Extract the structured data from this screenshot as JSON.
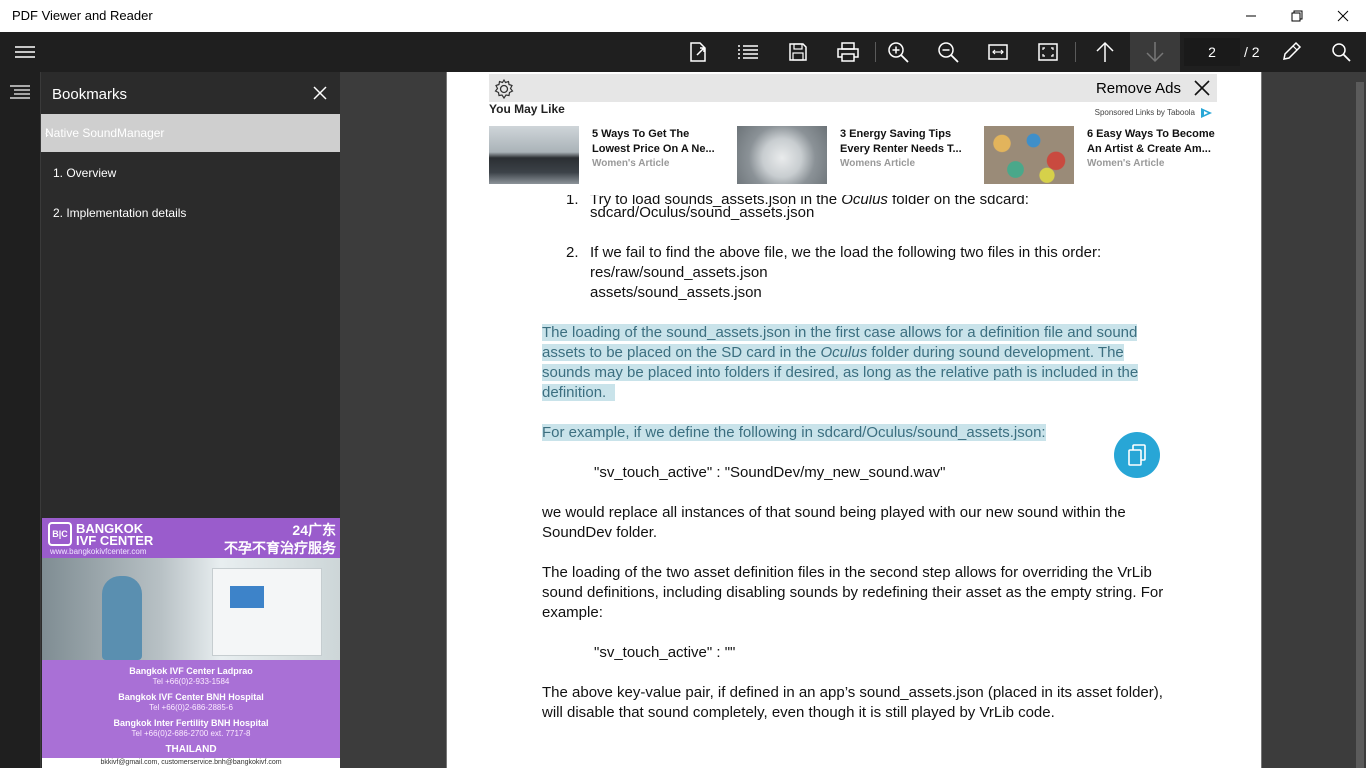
{
  "window": {
    "title": "PDF Viewer and Reader"
  },
  "toolbar": {
    "current_page": "2",
    "total_pages": "/ 2"
  },
  "bookmarks": {
    "title": "Bookmarks",
    "selected": "Native SoundManager",
    "items": [
      "1. Overview",
      "2. Implementation details"
    ]
  },
  "side_ad": {
    "logo": "B|C",
    "brand_line1": "BANGKOK",
    "brand_line2": "IVF CENTER",
    "url": "www.bangkokivfcenter.com",
    "cn_line1": "24广东",
    "cn_line2": "不孕不育治疗服务",
    "locations": [
      {
        "name": "Bangkok IVF Center Ladprao",
        "tel": "Tel +66(0)2-933-1584"
      },
      {
        "name": "Bangkok IVF Center BNH Hospital",
        "tel": "Tel +66(0)2-686-2885-6"
      },
      {
        "name": "Bangkok Inter Fertility BNH Hospital",
        "tel": "Tel +66(0)2-686-2700 ext. 7717-8"
      }
    ],
    "country": "THAILAND",
    "email": "bkkivf@gmail.com, customerservice.bnh@bangkokivf.com"
  },
  "ad_banner": {
    "remove_ads": "Remove Ads",
    "you_may_like": "You May Like",
    "sponsored": "Sponsored Links by Taboola",
    "items": [
      {
        "title": "5 Ways To Get The Lowest Price On A Ne...",
        "source": "Women's Article"
      },
      {
        "title": "3 Energy Saving Tips Every Renter Needs T...",
        "source": "Womens Article"
      },
      {
        "title": "6 Easy Ways To Become An Artist & Create Am...",
        "source": "Women's Article"
      }
    ]
  },
  "document": {
    "item1_num": "1.",
    "item1_line1a": "Try to load sounds_assets.json in the ",
    "item1_line1b": "Oculus",
    "item1_line1c": " folder on the sdcard:",
    "item1_line2": "sdcard/Oculus/sound_assets.json",
    "item2_num": "2.",
    "item2_line1": "If we fail to find the above file, we the load the following two files in this order:",
    "item2_line2": "res/raw/sound_assets.json",
    "item2_line3": "assets/sound_assets.json",
    "hl_line1": "The loading of the sound_assets.json in the first case allows for a definition file and sound",
    "hl_line2a": "assets to be placed on the SD card in the ",
    "hl_line2b": "Oculus",
    "hl_line2c": " folder during sound development. The",
    "hl_line3": "sounds may be placed into folders if desired, as long as the relative path is included in the",
    "hl_line4": "definition.  ",
    "hl_example": "For example, if we define the following in sdcard/Oculus/sound_assets.json:",
    "code1": "\"sv_touch_active\" : \"SoundDev/my_new_sound.wav\"",
    "p1_line1": "we would replace all instances of that sound being played with our new sound within the",
    "p1_line2": "SoundDev folder.",
    "p2_line1": "The loading of the two asset definition files in the second step allows for overriding the VrLib",
    "p2_line2": "sound definitions, including disabling sounds by redefining their asset as the empty string. For",
    "p2_line3": "example:",
    "code2": "\"sv_touch_active\" : \"\"",
    "p3_line1": "The above key-value pair, if defined in an app’s sound_assets.json (placed in its asset folder),",
    "p3_line2": "will disable that sound completely, even though it is still played by VrLib code."
  }
}
